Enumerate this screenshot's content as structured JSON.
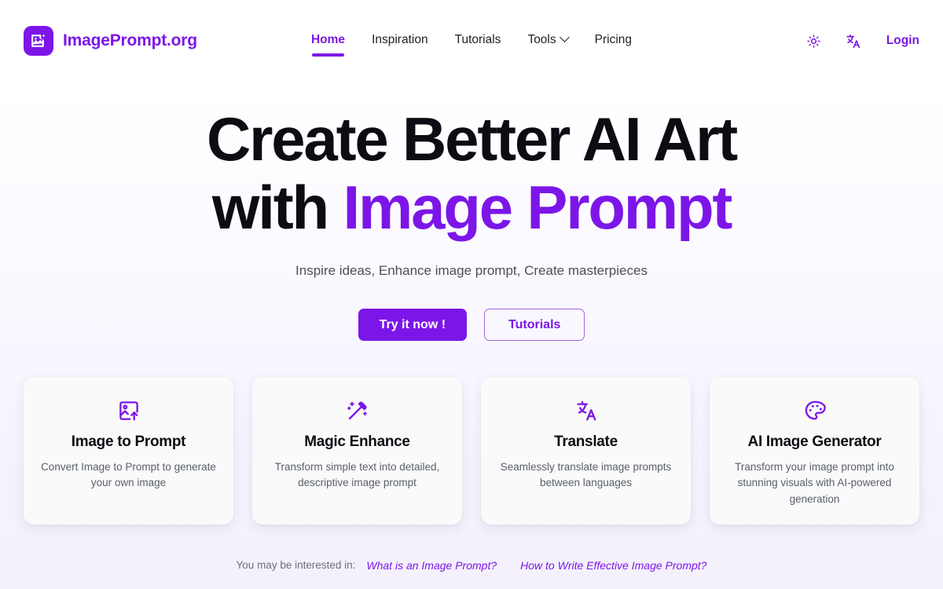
{
  "brand": {
    "name": "ImagePrompt.org",
    "logo_icon": "image-sparkle-icon"
  },
  "nav": {
    "items": [
      {
        "label": "Home",
        "active": true
      },
      {
        "label": "Inspiration",
        "active": false
      },
      {
        "label": "Tutorials",
        "active": false
      },
      {
        "label": "Tools",
        "active": false,
        "has_dropdown": true
      },
      {
        "label": "Pricing",
        "active": false
      }
    ],
    "theme_toggle_icon": "sun-icon",
    "language_icon": "translate-icon",
    "login_label": "Login"
  },
  "hero": {
    "title_line1": "Create Better AI Art",
    "title_line2_plain": "with ",
    "title_line2_accent": "Image Prompt",
    "subtitle": "Inspire ideas, Enhance image prompt, Create masterpieces",
    "primary_cta": "Try it now !",
    "secondary_cta": "Tutorials"
  },
  "cards": [
    {
      "icon": "image-upload-icon",
      "title": "Image to Prompt",
      "description": "Convert Image to Prompt to generate your own image"
    },
    {
      "icon": "magic-wand-icon",
      "title": "Magic Enhance",
      "description": "Transform simple text into detailed, descriptive image prompt"
    },
    {
      "icon": "translate-icon",
      "title": "Translate",
      "description": "Seamlessly translate image prompts between languages"
    },
    {
      "icon": "palette-icon",
      "title": "AI Image Generator",
      "description": "Transform your image prompt into stunning visuals with AI-powered generation"
    }
  ],
  "interest": {
    "label": "You may be interested in:",
    "links": [
      "What is an Image Prompt?",
      "How to Write Effective Image Prompt?"
    ]
  },
  "colors": {
    "brand_purple": "#7c16e8",
    "heading_dark": "#0b0d12",
    "body_gray": "#5a6069",
    "card_bg": "#fafafb",
    "page_bg_top": "#ffffff",
    "page_bg_bottom": "#f4f1fc"
  }
}
